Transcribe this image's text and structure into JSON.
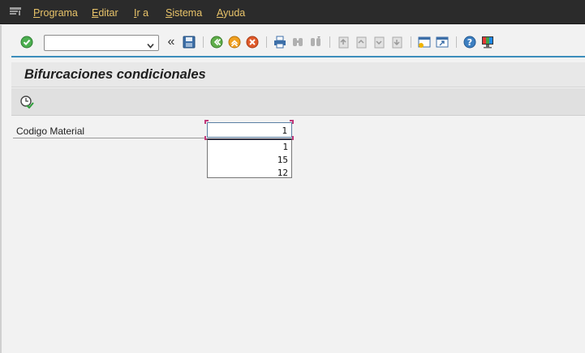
{
  "menu": {
    "items": [
      {
        "label": "Programa",
        "accel": "P",
        "rest": "rograma"
      },
      {
        "label": "Editar",
        "accel": "E",
        "rest": "ditar"
      },
      {
        "label": "Ir a",
        "accel": "I",
        "rest": "r a"
      },
      {
        "label": "Sistema",
        "accel": "S",
        "rest": "istema"
      },
      {
        "label": "Ayuda",
        "accel": "A",
        "rest": "yuda"
      }
    ]
  },
  "toolbar": {
    "command_field_value": "",
    "icons": [
      "enter-icon",
      "command-dropdown-icon",
      "collapse-icon",
      "save-icon",
      "back-icon",
      "exit-icon",
      "cancel-icon",
      "print-icon",
      "find-icon",
      "find-next-icon",
      "first-page-icon",
      "previous-page-icon",
      "next-page-icon",
      "last-page-icon",
      "create-session-icon",
      "shortcut-icon",
      "help-icon",
      "customize-layout-icon"
    ],
    "collapse_glyph": "«",
    "accent_line_color": "#3c8dbc"
  },
  "title": {
    "text": "Bifurcaciones condicionales"
  },
  "app_toolbar": {
    "icons": [
      "execute-icon"
    ]
  },
  "form": {
    "field_label": "Codigo Material",
    "field_value": "1",
    "history_options": [
      "1",
      "15",
      "12"
    ]
  }
}
